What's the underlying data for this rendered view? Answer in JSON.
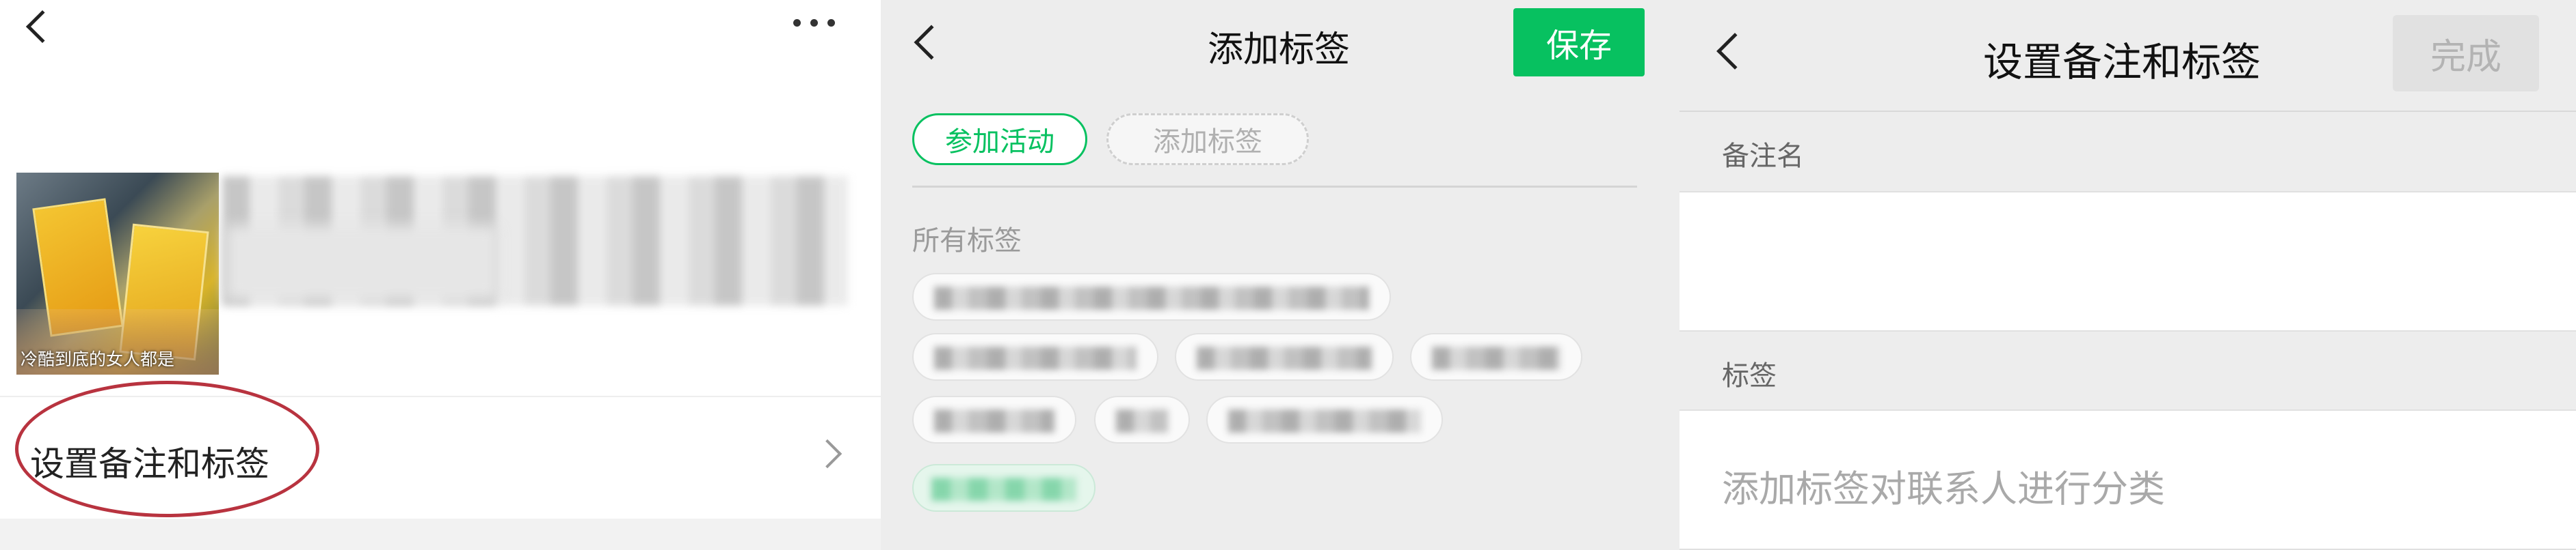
{
  "profile": {
    "avatar_caption": "冷酷到底的女人都是",
    "remark_row_label": "设置备注和标签",
    "icons": {
      "back": "back-chevron-icon",
      "more": "more-dots-icon",
      "row_arrow": "chevron-right-icon"
    }
  },
  "add_tags": {
    "title": "添加标签",
    "save_label": "保存",
    "selected_tag": "参加活动",
    "add_tag_placeholder": "添加标签",
    "all_tags_label": "所有标签",
    "colors": {
      "accent": "#07c160"
    }
  },
  "remark_settings": {
    "title": "设置备注和标签",
    "done_label": "完成",
    "remark_section_label": "备注名",
    "remark_value": "",
    "tags_section_label": "标签",
    "tags_placeholder": "添加标签对联系人进行分类"
  }
}
